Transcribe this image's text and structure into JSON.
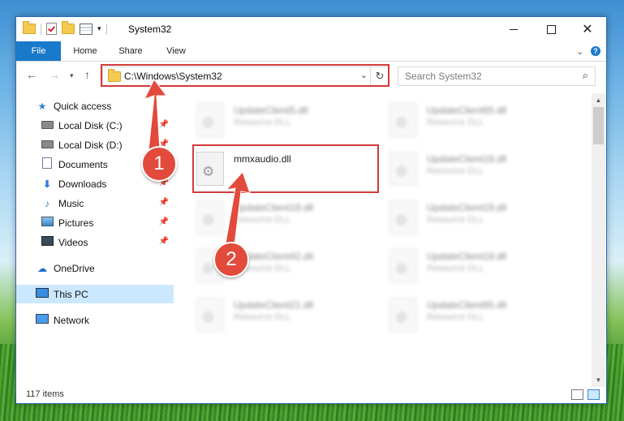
{
  "window": {
    "title": "System32"
  },
  "ribbon": {
    "tabs": [
      "File",
      "Home",
      "Share",
      "View"
    ]
  },
  "address": {
    "path": "C:\\Windows\\System32"
  },
  "search": {
    "placeholder": "Search System32"
  },
  "sidebar": {
    "items": [
      {
        "label": "Quick access",
        "icon": "star-icon"
      },
      {
        "label": "Local Disk (C:)",
        "icon": "drive-icon",
        "pinned": true
      },
      {
        "label": "Local Disk (D:)",
        "icon": "drive-icon",
        "pinned": true
      },
      {
        "label": "Documents",
        "icon": "documents-icon",
        "pinned": true
      },
      {
        "label": "Downloads",
        "icon": "downloads-icon",
        "pinned": true
      },
      {
        "label": "Music",
        "icon": "music-icon",
        "pinned": true
      },
      {
        "label": "Pictures",
        "icon": "pictures-icon",
        "pinned": true
      },
      {
        "label": "Videos",
        "icon": "videos-icon",
        "pinned": true
      },
      {
        "label": "OneDrive",
        "icon": "onedrive-icon"
      },
      {
        "label": "This PC",
        "icon": "this-pc-icon",
        "selected": true
      },
      {
        "label": "Network",
        "icon": "network-icon"
      }
    ]
  },
  "files": {
    "highlighted": {
      "name": "mmxaudio.dll"
    },
    "background": [
      {
        "name": "UpdateClient5.dll",
        "desc": "Resource DLL"
      },
      {
        "name": "UpdateClient19.dll",
        "desc": "Resource DLL"
      },
      {
        "name": "UpdateClient42.dll",
        "desc": "Resource DLL"
      },
      {
        "name": "UpdateClient21.dll",
        "desc": "Resource DLL"
      },
      {
        "name": "UpdateClient65.dll",
        "desc": "Resource DLL"
      },
      {
        "name": "UpdateClient19.dll",
        "desc": "Resource DLL"
      },
      {
        "name": "UpdateClient19.dll",
        "desc": "Resource DLL"
      },
      {
        "name": "UpdateClient19.dll",
        "desc": "Resource DLL"
      },
      {
        "name": "UpdateClient65.dll",
        "desc": "Resource DLL"
      }
    ]
  },
  "status": {
    "count": "117 items"
  },
  "annotations": {
    "badge1": "1",
    "badge2": "2"
  },
  "colors": {
    "accent": "#1979ca",
    "highlight": "#d23a3a",
    "selected": "#cce8ff"
  }
}
